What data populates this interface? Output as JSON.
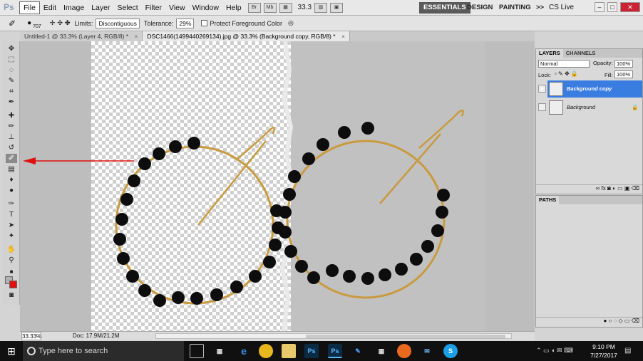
{
  "app": {
    "logo": "Ps"
  },
  "menu": [
    "File",
    "Edit",
    "Image",
    "Layer",
    "Select",
    "Filter",
    "View",
    "Window",
    "Help"
  ],
  "menubar": {
    "zoom": "33.3",
    "workspaces": [
      "ESSENTIALS",
      "DESIGN",
      "PAINTING"
    ],
    "overflow": ">>",
    "cs_live": "CS Live"
  },
  "options": {
    "brush_size": "707",
    "limits_label": "Limits:",
    "limits_value": "Discontiguous",
    "tolerance_label": "Tolerance:",
    "tolerance_value": "29%",
    "protect_fg": "Protect Foreground Color"
  },
  "tabs": [
    {
      "label": "Untitled-1 @ 33.3% (Layer 4, RGB/8) *",
      "close": "×"
    },
    {
      "label": "DSC1466(1499440269134).jpg @ 33.3% (Background copy, RGB/8) *",
      "close": "×"
    }
  ],
  "status": {
    "zoom": "33.33%",
    "doc": "Doc: 17.9M/21.2M"
  },
  "layers_panel": {
    "tabs": [
      "LAYERS",
      "CHANNELS"
    ],
    "blend_mode": "Normal",
    "opacity_label": "Opacity:",
    "opacity_value": "100%",
    "lock_label": "Lock:",
    "fill_label": "Fill:",
    "fill_value": "100%",
    "layers": [
      {
        "name": "Background copy",
        "selected": true
      },
      {
        "name": "Background",
        "selected": false
      }
    ]
  },
  "paths_panel": {
    "tab": "PATHS"
  },
  "taskbar": {
    "search_placeholder": "Type here to search",
    "time": "9:10 PM",
    "date": "7/27/2017"
  },
  "colors": {
    "accent": "#3a7de0",
    "arrow": "#e01010",
    "bead": "#0d0d0d",
    "wire": "#c99a3e"
  }
}
